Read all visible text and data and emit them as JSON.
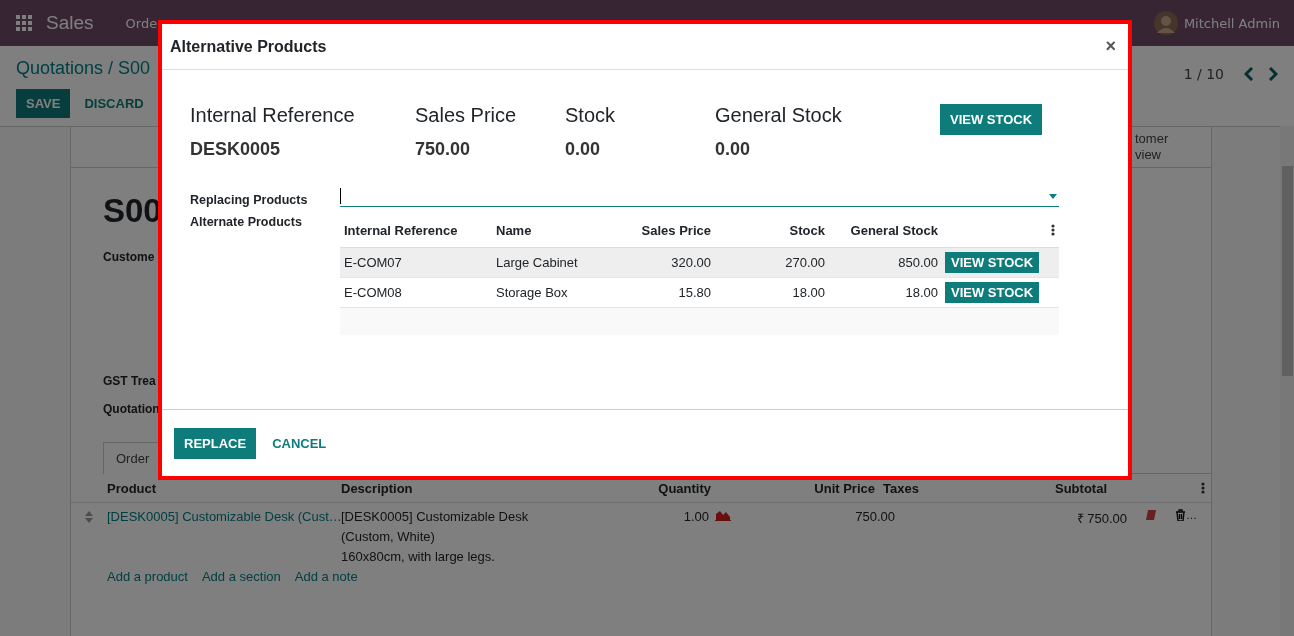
{
  "navbar": {
    "app": "Sales",
    "menu": [
      "Orde"
    ],
    "user": "Mitchell Admin"
  },
  "control_panel": {
    "breadcrumb": "Quotations / S00",
    "buttons": [
      {
        "label": "SAVE",
        "kind": "primary"
      },
      {
        "label": "DISCARD",
        "kind": "link"
      }
    ],
    "pager": "1 / 10"
  },
  "sheet": {
    "smart_button": [
      "tomer",
      "view"
    ],
    "title": "S00",
    "fields": [
      "Custome",
      "GST Trea",
      "Quotation"
    ],
    "tabs": [
      {
        "label": "Order",
        "selected": true
      }
    ],
    "order_lines": {
      "columns": [
        "Product",
        "Description",
        "Quantity",
        "Unit Price",
        "Taxes",
        "Subtotal"
      ],
      "rows": [
        {
          "product": "[DESK0005] Customizable Desk (Cust…",
          "description": [
            "[DESK0005] Customizable Desk",
            "(Custom, White)",
            "160x80cm, with large legs."
          ],
          "quantity": "1.00",
          "unit_price": "750.00",
          "subtotal": "₹ 750.00",
          "trailing": "…"
        }
      ],
      "links": [
        "Add a product",
        "Add a section",
        "Add a note"
      ]
    }
  },
  "dialog": {
    "title": "Alternative Products",
    "close": "×",
    "summary": [
      {
        "label": "Internal Reference",
        "value": "DESK0005"
      },
      {
        "label": "Sales Price",
        "value": "750.00"
      },
      {
        "label": "Stock",
        "value": "0.00"
      },
      {
        "label": "General Stock",
        "value": "0.00"
      }
    ],
    "summary_button": "VIEW STOCK",
    "replacing_label": "Replacing Products",
    "alternate_label": "Alternate Products",
    "table": {
      "columns": [
        "Internal Reference",
        "Name",
        "Sales Price",
        "Stock",
        "General Stock"
      ],
      "rows": [
        {
          "ref": "E-COM07",
          "name": "Large Cabinet",
          "price": "320.00",
          "stock": "270.00",
          "general": "850.00",
          "button": "VIEW STOCK",
          "selected": true
        },
        {
          "ref": "E-COM08",
          "name": "Storage Box",
          "price": "15.80",
          "stock": "18.00",
          "general": "18.00",
          "button": "VIEW STOCK",
          "selected": false
        }
      ]
    },
    "buttons": [
      {
        "label": "REPLACE",
        "kind": "primary"
      },
      {
        "label": "CANCEL",
        "kind": "link"
      }
    ]
  }
}
